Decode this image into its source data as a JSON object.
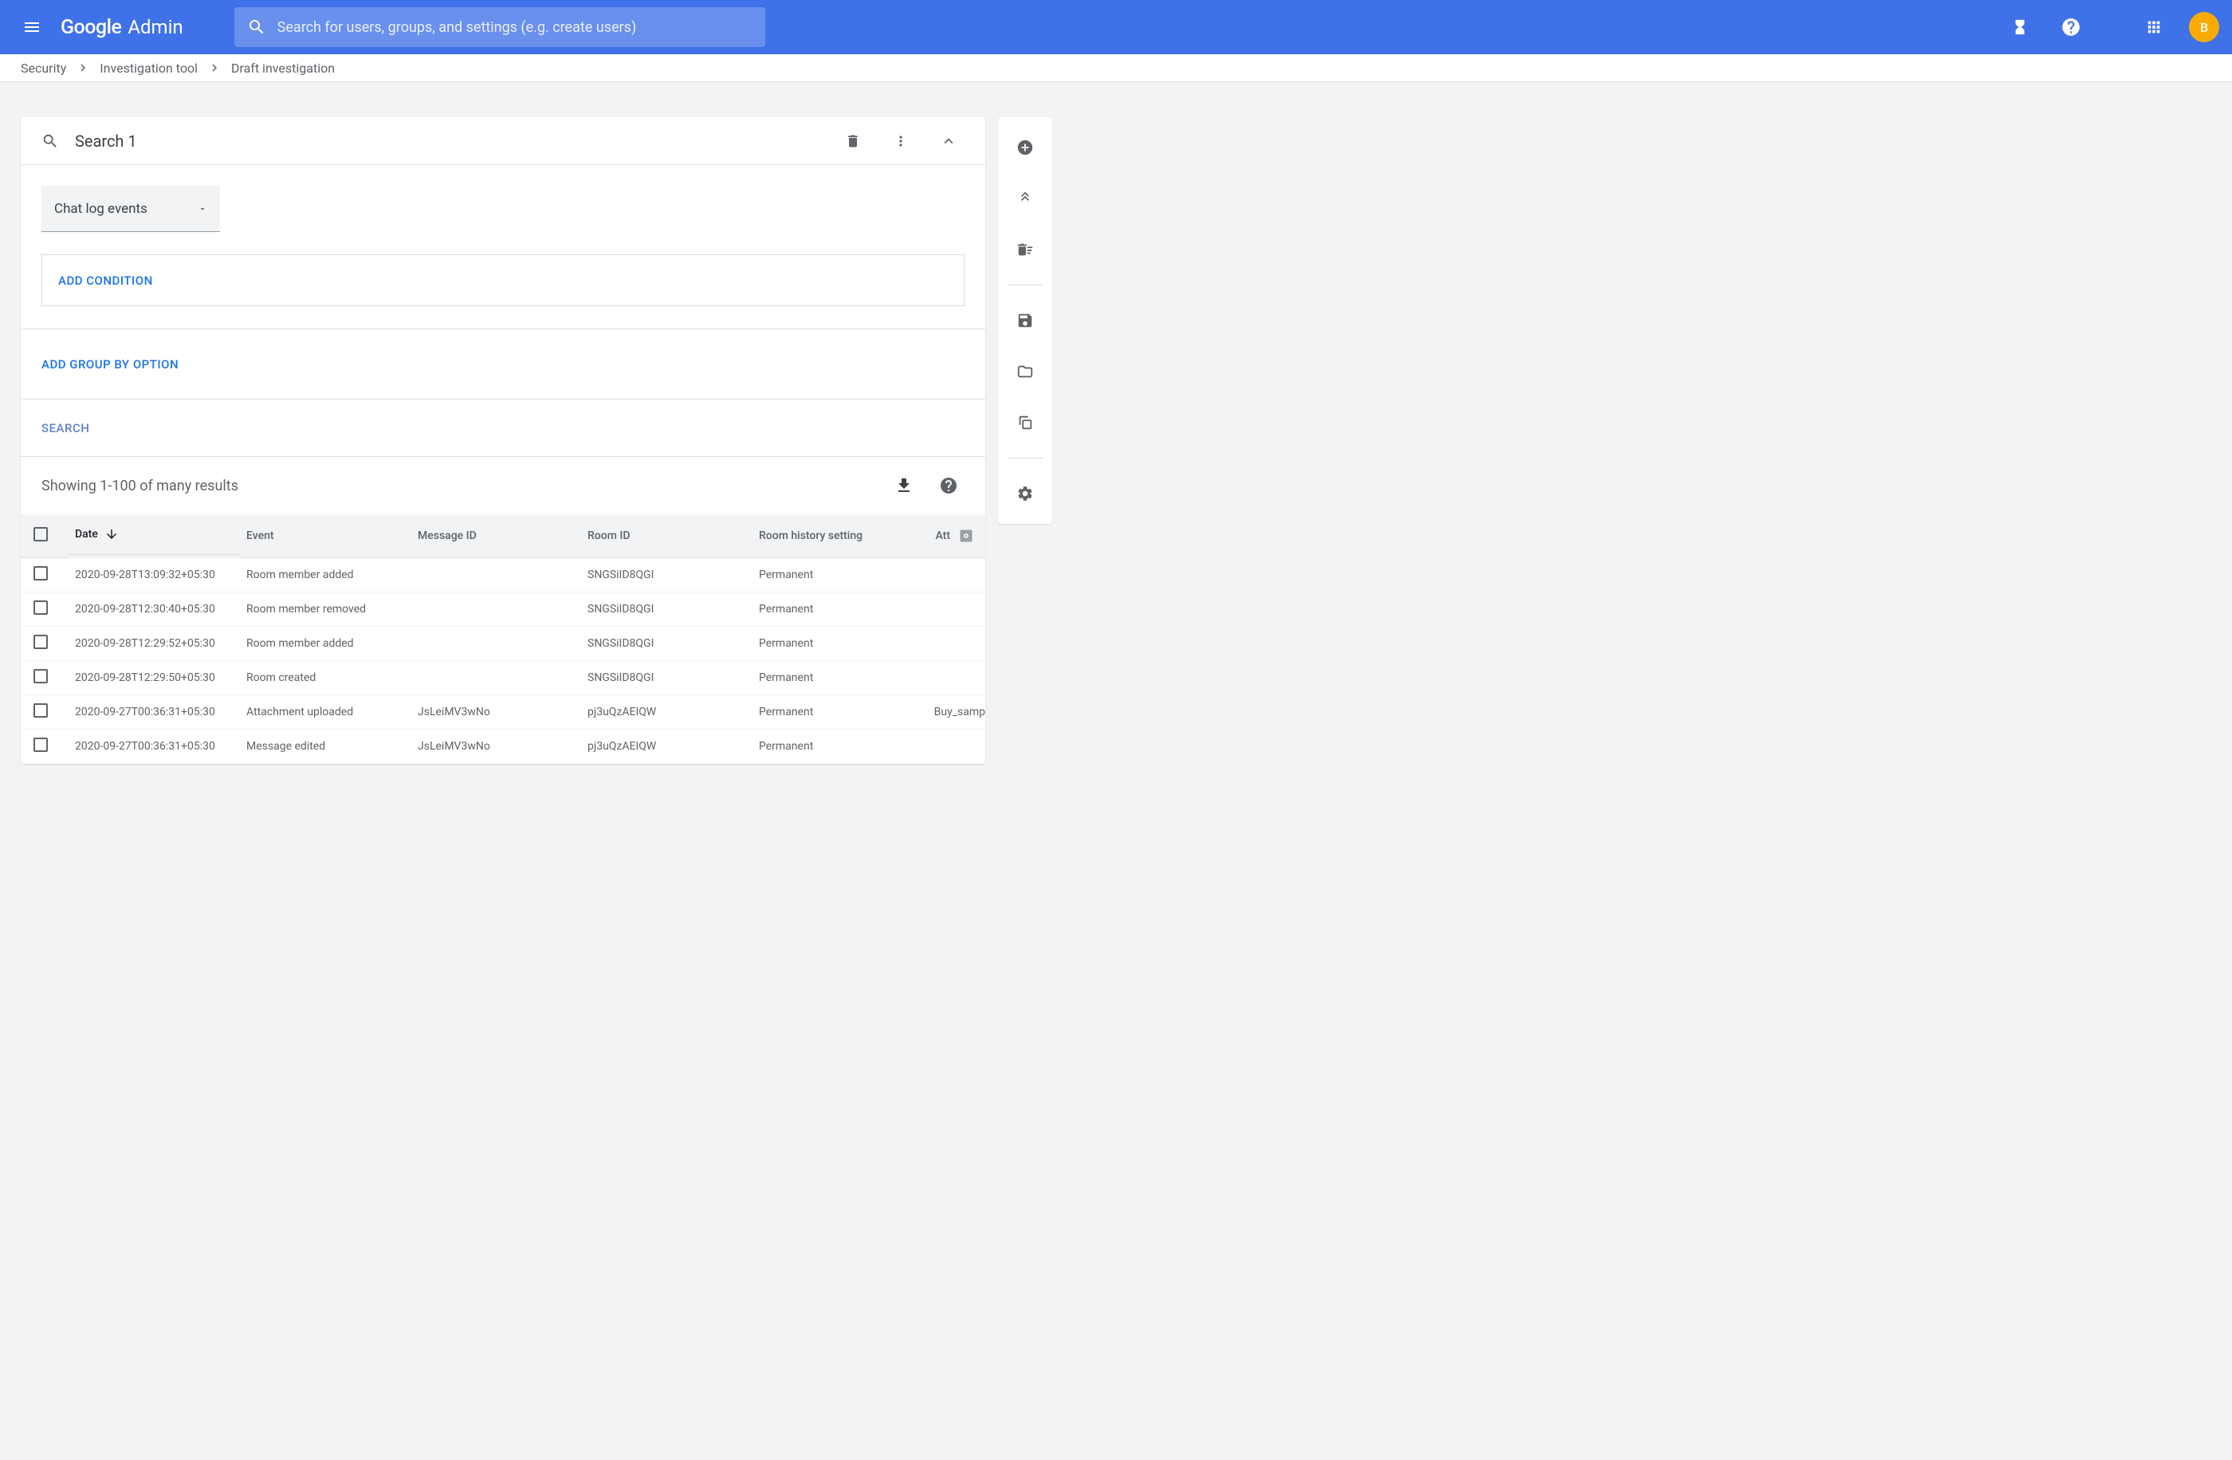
{
  "header": {
    "logo_google": "Google",
    "logo_admin": "Admin",
    "search_placeholder": "Search for users, groups, and settings (e.g. create users)",
    "avatar_letter": "B"
  },
  "breadcrumb": {
    "items": [
      "Security",
      "Investigation tool",
      "Draft investigation"
    ]
  },
  "card": {
    "title": "Search 1",
    "data_source": "Chat log events",
    "add_condition": "ADD CONDITION",
    "add_group_by": "ADD GROUP BY OPTION",
    "search_button": "SEARCH"
  },
  "results": {
    "summary": "Showing 1-100 of many results"
  },
  "table": {
    "columns": {
      "date": "Date",
      "event": "Event",
      "message_id": "Message ID",
      "room_id": "Room ID",
      "room_history": "Room history setting",
      "attachment": "Att"
    },
    "rows": [
      {
        "date": "2020-09-28T13:09:32+05:30",
        "event": "Room member added",
        "message_id": "",
        "room_id": "SNGSiID8QGI",
        "history": "Permanent",
        "att": ""
      },
      {
        "date": "2020-09-28T12:30:40+05:30",
        "event": "Room member removed",
        "message_id": "",
        "room_id": "SNGSiID8QGI",
        "history": "Permanent",
        "att": ""
      },
      {
        "date": "2020-09-28T12:29:52+05:30",
        "event": "Room member added",
        "message_id": "",
        "room_id": "SNGSiID8QGI",
        "history": "Permanent",
        "att": ""
      },
      {
        "date": "2020-09-28T12:29:50+05:30",
        "event": "Room created",
        "message_id": "",
        "room_id": "SNGSiID8QGI",
        "history": "Permanent",
        "att": ""
      },
      {
        "date": "2020-09-27T00:36:31+05:30",
        "event": "Attachment uploaded",
        "message_id": "JsLeiMV3wNo",
        "room_id": "pj3uQzAEIQW",
        "history": "Permanent",
        "att": "Buy_samp"
      },
      {
        "date": "2020-09-27T00:36:31+05:30",
        "event": "Message edited",
        "message_id": "JsLeiMV3wNo",
        "room_id": "pj3uQzAEIQW",
        "history": "Permanent",
        "att": ""
      }
    ]
  }
}
